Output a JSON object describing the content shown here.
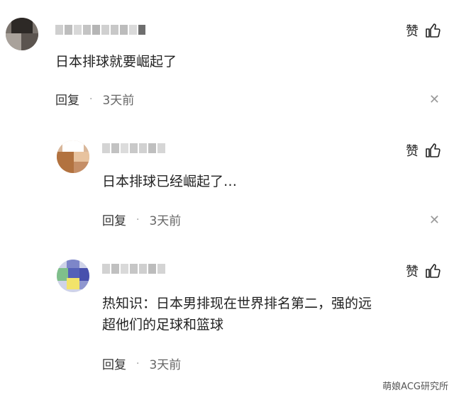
{
  "comments": [
    {
      "text": "日本排球就要崛起了",
      "reply_label": "回复",
      "time": "3天前",
      "like_label": "赞",
      "avatar": "blurred-avatar",
      "username": "blurred-username"
    },
    {
      "text": "日本排球已经崛起了…",
      "reply_label": "回复",
      "time": "3天前",
      "like_label": "赞",
      "avatar": "blurred-avatar",
      "username": "blurred-username"
    },
    {
      "text_line1": "热知识：日本男排现在世界排名第二，强的远",
      "text_line2": "超他们的足球和篮球",
      "reply_label": "回复",
      "time": "3天前",
      "like_label": "赞",
      "avatar": "blurred-avatar",
      "username": "blurred-username"
    }
  ],
  "icons": {
    "like": "thumbs-up-icon",
    "close": "close-icon"
  },
  "watermark": "萌娘ACG研究所"
}
